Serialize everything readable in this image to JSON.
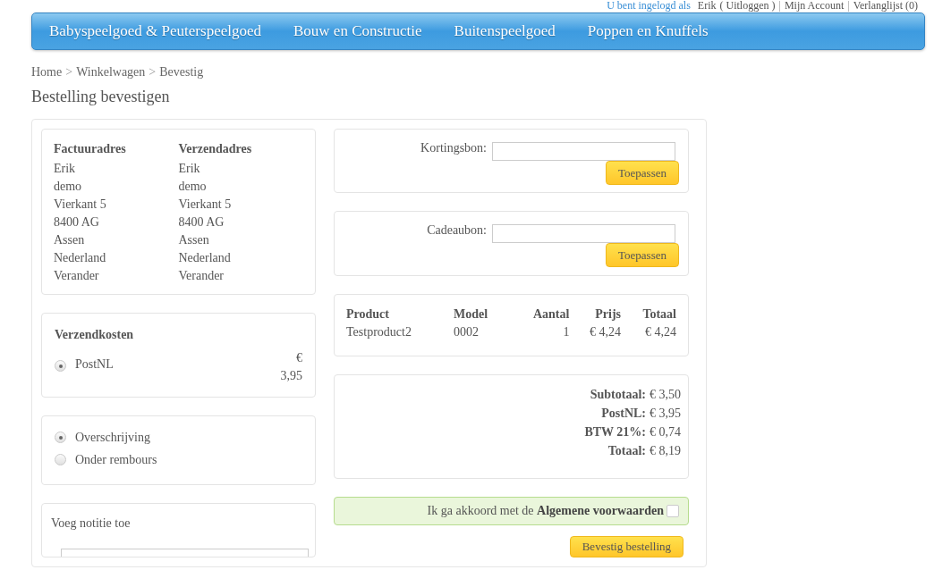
{
  "account_bar": {
    "greeting": "U bent ingelogd als",
    "user": "Erik",
    "logout": "( Uitloggen )",
    "separator": "|",
    "links": [
      "Mijn Account",
      "Verlanglijst (0)"
    ]
  },
  "nav": {
    "items": [
      "Babyspeelgoed & Peuterspeelgoed",
      "Bouw en Constructie",
      "Buitenspeelgoed",
      "Poppen en Knuffels"
    ]
  },
  "breadcrumb": {
    "items": [
      "Home",
      "Winkelwagen",
      "Bevestig"
    ],
    "separator": ">"
  },
  "page_title": "Bestelling bevestigen",
  "addresses": [
    {
      "heading": "Factuuradres",
      "lines": [
        "Erik",
        "demo",
        "Vierkant 5",
        "8400 AG",
        "Assen",
        "Nederland"
      ],
      "change_link": "Verander"
    },
    {
      "heading": "Verzendadres",
      "lines": [
        "Erik",
        "demo",
        "Vierkant 5",
        "8400 AG",
        "Assen",
        "Nederland"
      ],
      "change_link": "Verander"
    }
  ],
  "shipping": {
    "heading": "Verzendkosten",
    "options": [
      {
        "label": "PostNL",
        "price": "€ 3,95",
        "selected": true
      }
    ]
  },
  "payment": {
    "options": [
      {
        "label": "Overschrijving",
        "selected": true
      },
      {
        "label": "Onder rembours",
        "selected": false
      }
    ]
  },
  "note": {
    "label": "Voeg notitie toe"
  },
  "coupons": [
    {
      "label": "Kortingsbon:",
      "button": "Toepassen"
    },
    {
      "label": "Cadeaubon:",
      "button": "Toepassen"
    }
  ],
  "cart_table": {
    "columns": [
      "Product",
      "Model",
      "Aantal",
      "Prijs",
      "Totaal"
    ],
    "rows": [
      [
        "Testproduct2",
        "0002",
        "1",
        "€ 4,24",
        "€ 4,24"
      ]
    ]
  },
  "totals": [
    {
      "label": "Subtotaal:",
      "value": "€ 3,50"
    },
    {
      "label": "PostNL:",
      "value": "€ 3,95"
    },
    {
      "label": "BTW 21%:",
      "value": "€ 0,74"
    },
    {
      "label": "Totaal:",
      "value": "€ 8,19"
    }
  ],
  "agreement": {
    "text": "Ik ga akkoord met de **Algemene voorwaarden**",
    "checked": false
  },
  "confirm_button": "Bevestig bestelling"
}
